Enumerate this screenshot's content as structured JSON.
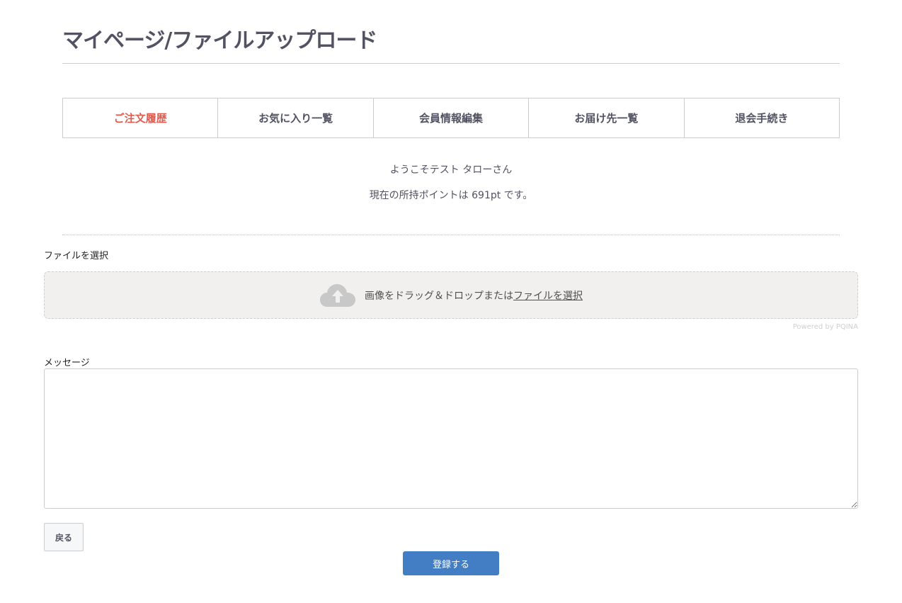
{
  "header": {
    "title": "マイページ/ファイルアップロード"
  },
  "nav": {
    "items": [
      {
        "label": "ご注文履歴",
        "active": true
      },
      {
        "label": "お気に入り一覧",
        "active": false
      },
      {
        "label": "会員情報編集",
        "active": false
      },
      {
        "label": "お届け先一覧",
        "active": false
      },
      {
        "label": "退会手続き",
        "active": false
      }
    ]
  },
  "welcome": {
    "greeting": "ようこそテスト タローさん",
    "points": "現在の所持ポイントは 691pt です。"
  },
  "upload": {
    "label": "ファイルを選択",
    "drop_text": "画像をドラッグ＆ドロップまたは",
    "browse_link": "ファイルを選択",
    "powered_by": "Powered by PQINA",
    "icon": "cloud-upload-icon"
  },
  "message": {
    "label": "メッセージ",
    "value": "",
    "placeholder": ""
  },
  "actions": {
    "back_label": "戻る",
    "submit_label": "登録する"
  },
  "colors": {
    "accent": "#de5d50",
    "primary_button": "#437ec4",
    "text": "#525263",
    "dropzone_bg": "#f1f0ef"
  }
}
